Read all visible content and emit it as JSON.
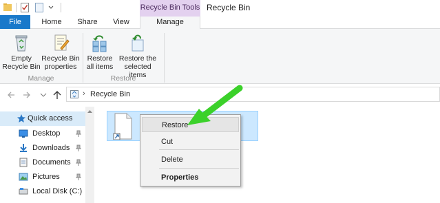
{
  "window": {
    "contextual_tab_group": "Recycle Bin Tools",
    "title": "Recycle Bin"
  },
  "ribbon_tabs": [
    {
      "label": "File"
    },
    {
      "label": "Home"
    },
    {
      "label": "Share"
    },
    {
      "label": "View"
    },
    {
      "label": "Manage"
    }
  ],
  "ribbon": {
    "groups": [
      {
        "label": "Manage",
        "buttons": [
          {
            "line1": "Empty",
            "line2": "Recycle Bin",
            "icon": "recycle-bin-icon"
          },
          {
            "line1": "Recycle Bin",
            "line2": "properties",
            "icon": "properties-icon"
          }
        ]
      },
      {
        "label": "Restore",
        "buttons": [
          {
            "line1": "Restore",
            "line2": "all items",
            "icon": "restore-all-icon"
          },
          {
            "line1": "Restore the",
            "line2": "selected items",
            "icon": "restore-selected-icon"
          }
        ]
      }
    ]
  },
  "address": {
    "path": "Recycle Bin",
    "separator": "›"
  },
  "nav_pane": {
    "items": [
      {
        "label": "Quick access",
        "icon": "star-icon",
        "pinned": false,
        "selected": true
      },
      {
        "label": "Desktop",
        "icon": "desktop-icon",
        "pinned": true
      },
      {
        "label": "Downloads",
        "icon": "download-icon",
        "pinned": true
      },
      {
        "label": "Documents",
        "icon": "documents-icon",
        "pinned": true
      },
      {
        "label": "Pictures",
        "icon": "pictures-icon",
        "pinned": true
      },
      {
        "label": "Local Disk (C:)",
        "icon": "drive-icon",
        "pinned": false
      }
    ]
  },
  "context_menu": {
    "items": [
      {
        "label": "Restore",
        "highlighted": true
      },
      {
        "label": "Cut"
      },
      {
        "label": "Delete"
      },
      {
        "label": "Properties",
        "bold": true
      }
    ]
  },
  "colors": {
    "file_tab": "#1979ca",
    "contextual_tab": "#e3d1ef",
    "selection": "#cce8ff",
    "annotation_arrow": "#3bd12a"
  }
}
